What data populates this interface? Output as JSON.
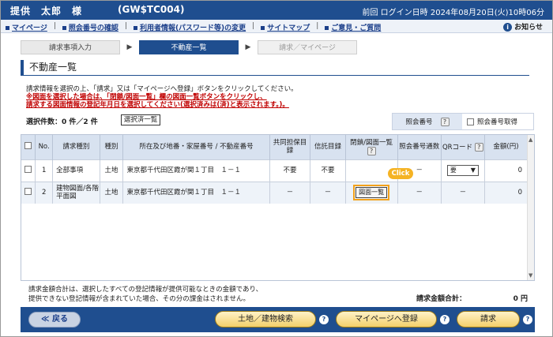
{
  "header": {
    "user_name": "提供　太郎　様",
    "user_id": "(GW$TC004)",
    "last_login": "前回 ログイン日時 2024年08月20日(火)10時06分"
  },
  "nav": {
    "links": [
      "マイページ",
      "照会番号の確認",
      "利用者情報(パスワード等)の変更",
      "サイトマップ",
      "ご意見・ご質問"
    ],
    "notice": "お知らせ"
  },
  "steps": [
    "請求事項入力",
    "不動産一覧",
    "請求／マイページ"
  ],
  "page_title": "不動産一覧",
  "instructions": {
    "line1": "請求情報を選択の上、「請求」又は「マイページへ登録」ボタンをクリックしてください。",
    "line2": "※図面を選択した場合は、「閉鎖/図面一覧」欄の図面一覧ボタンをクリックし、",
    "line3": "請求する図面情報の登記年月日を選択してください(選択済みは(済)と表示されます。)。"
  },
  "selection": {
    "count_text": "選択件数：0 件／2 件",
    "selected_button": "選択済一覧"
  },
  "reference": {
    "label": "照会番号",
    "help": "?",
    "checkbox_label": "照会番号取得"
  },
  "table": {
    "headers": [
      "No.",
      "請求種別",
      "種別",
      "所在及び地番・家屋番号 / 不動産番号",
      "共同担保目録",
      "信託目録",
      "閉鎖/図面一覧",
      "照会番号通数",
      "QRコード",
      "金額(円)"
    ],
    "rows": [
      {
        "no": "1",
        "type": "全部事項",
        "kind": "土地",
        "location": "東京都千代田区霞が関１丁目　１－１",
        "kyodo": "不要",
        "shintaku": "不要",
        "heisa": "",
        "tsusu": "－",
        "qr": "要",
        "amount": "0"
      },
      {
        "no": "2",
        "type": "建物図面/各階平面図",
        "kind": "土地",
        "location": "東京都千代田区霞が関１丁目　１－１",
        "kyodo": "－",
        "shintaku": "－",
        "heisa": "図面一覧",
        "tsusu": "－",
        "qr": "－",
        "amount": "0"
      }
    ],
    "click_badge": "Click"
  },
  "footer_note": {
    "line1": "請求金額合計は、選択したすべての登記情報が提供可能なときの金額であり、",
    "line2": "提供できない登記情報が含まれていた場合、その分の課金はされません。"
  },
  "total": {
    "label": "請求金額合計：",
    "value": "0 円"
  },
  "buttons": {
    "back": "≪ 戻る",
    "land_search": "土地／建物検索",
    "register_mypage": "マイページへ登録",
    "request": "請求",
    "help": "?"
  },
  "colors": {
    "brand_blue": "#1f4e8f",
    "accent_orange": "#f3a21b",
    "notice_red": "#c00000"
  }
}
